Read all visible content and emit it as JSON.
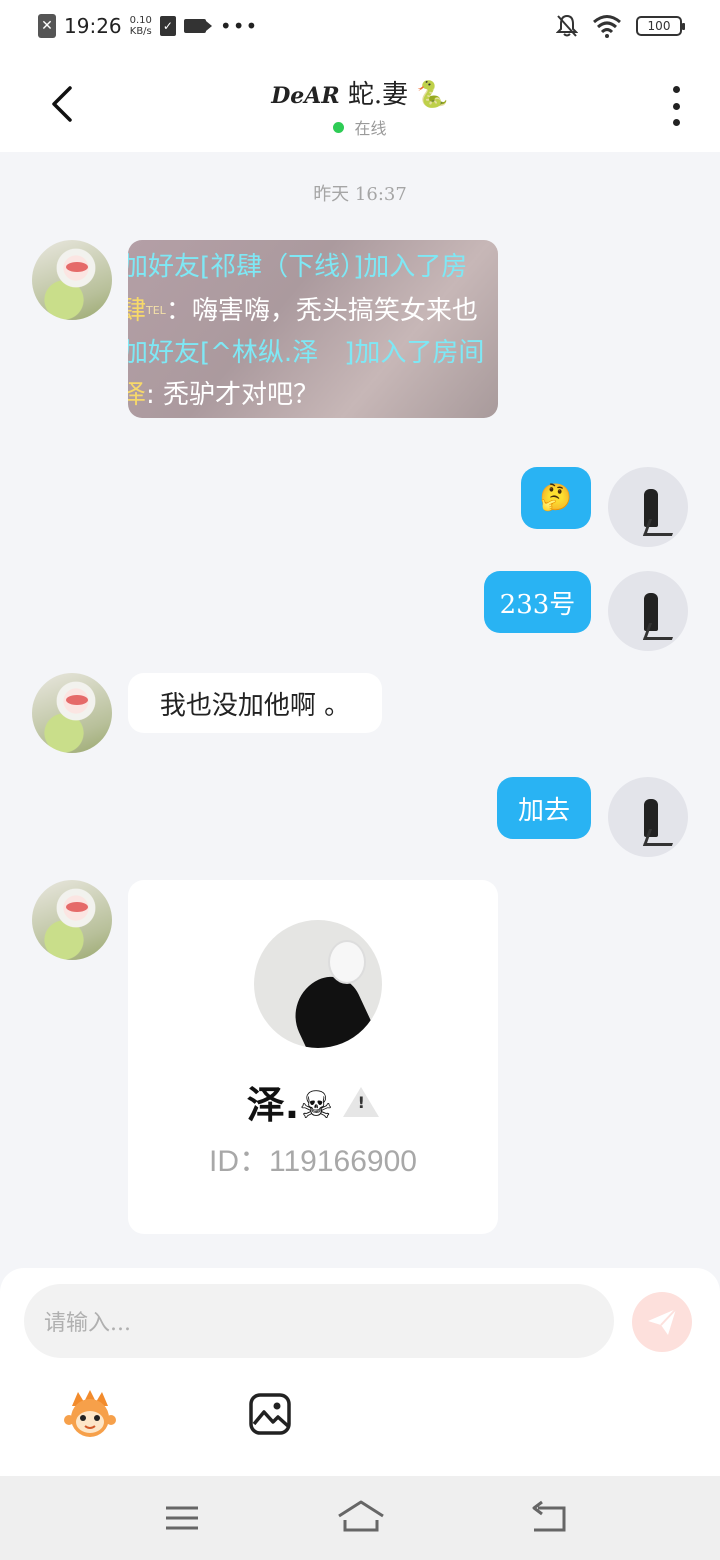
{
  "status_bar": {
    "time": "19:26",
    "net_speed_value": "0.10",
    "net_speed_unit": "KB/s",
    "battery": "100"
  },
  "header": {
    "title_script": "DeAR",
    "title_text": "蛇.妻",
    "title_emoji": "🐍",
    "status": "在线"
  },
  "chat": {
    "timestamp": "昨天 16:37",
    "image_lines": [
      {
        "cyan": "加好友[祁肆（下线）]加入了房"
      },
      {
        "yellow": "肆",
        "tel": "TEL",
        "white": "：嗨害嗨，秃头搞笑女来也"
      },
      {
        "cyan": "加好友[^林纵.泽　]加入了房间"
      },
      {
        "yellow": "泽",
        "white": ": 秃驴才对吧？"
      }
    ],
    "msg_emoji": "🤔",
    "msg_233": "233号",
    "msg_incoming": "我也没加他啊 。",
    "msg_go": "加去"
  },
  "contact_card": {
    "name": "泽.☠",
    "id_label": "ID：",
    "id_value": "119166900"
  },
  "input": {
    "placeholder": "请输入..."
  },
  "colors": {
    "outgoing_bubble": "#29b3f3",
    "online_dot": "#2ecc55",
    "send_button": "#fde0dc"
  },
  "icons": [
    "back-icon",
    "more-icon",
    "send-icon",
    "emoji-icon",
    "image-icon",
    "menu-icon",
    "home-icon",
    "back-nav-icon"
  ]
}
